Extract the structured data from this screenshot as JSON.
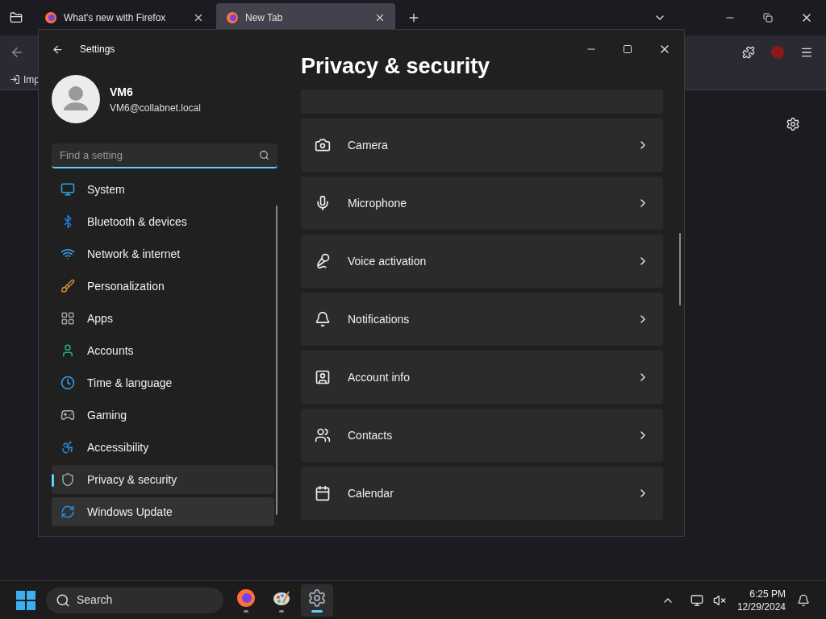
{
  "browser": {
    "tabs": [
      {
        "title": "What's new with Firefox",
        "selected": false
      },
      {
        "title": "New Tab",
        "selected": true
      }
    ],
    "bookmarks": [
      {
        "label": "Imp"
      }
    ]
  },
  "settings": {
    "title": "Settings",
    "user": {
      "name": "VM6",
      "email": "VM6@collabnet.local"
    },
    "search": {
      "placeholder": "Find a setting"
    },
    "nav": [
      {
        "label": "System",
        "kind": "system",
        "selected": false,
        "hovered": false
      },
      {
        "label": "Bluetooth & devices",
        "kind": "bluetooth",
        "selected": false,
        "hovered": false
      },
      {
        "label": "Network & internet",
        "kind": "network",
        "selected": false,
        "hovered": false
      },
      {
        "label": "Personalization",
        "kind": "brush",
        "selected": false,
        "hovered": false
      },
      {
        "label": "Apps",
        "kind": "apps",
        "selected": false,
        "hovered": false
      },
      {
        "label": "Accounts",
        "kind": "accounts",
        "selected": false,
        "hovered": false
      },
      {
        "label": "Time & language",
        "kind": "time",
        "selected": false,
        "hovered": false
      },
      {
        "label": "Gaming",
        "kind": "gaming",
        "selected": false,
        "hovered": false
      },
      {
        "label": "Accessibility",
        "kind": "accessibility",
        "selected": false,
        "hovered": false
      },
      {
        "label": "Privacy & security",
        "kind": "privacy",
        "selected": true,
        "hovered": false
      },
      {
        "label": "Windows Update",
        "kind": "update",
        "selected": false,
        "hovered": true
      }
    ],
    "heading": "Privacy & security",
    "items": [
      {
        "label": "Camera",
        "kind": "camera"
      },
      {
        "label": "Microphone",
        "kind": "mic"
      },
      {
        "label": "Voice activation",
        "kind": "voice"
      },
      {
        "label": "Notifications",
        "kind": "bell"
      },
      {
        "label": "Account info",
        "kind": "account"
      },
      {
        "label": "Contacts",
        "kind": "contacts"
      },
      {
        "label": "Calendar",
        "kind": "calendar"
      }
    ]
  },
  "taskbar": {
    "search": "Search",
    "apps": [
      {
        "kind": "firefox",
        "selected": false
      },
      {
        "kind": "paint",
        "selected": false
      },
      {
        "kind": "settings",
        "selected": true
      }
    ],
    "time": "6:25 PM",
    "date": "12/29/2024"
  }
}
